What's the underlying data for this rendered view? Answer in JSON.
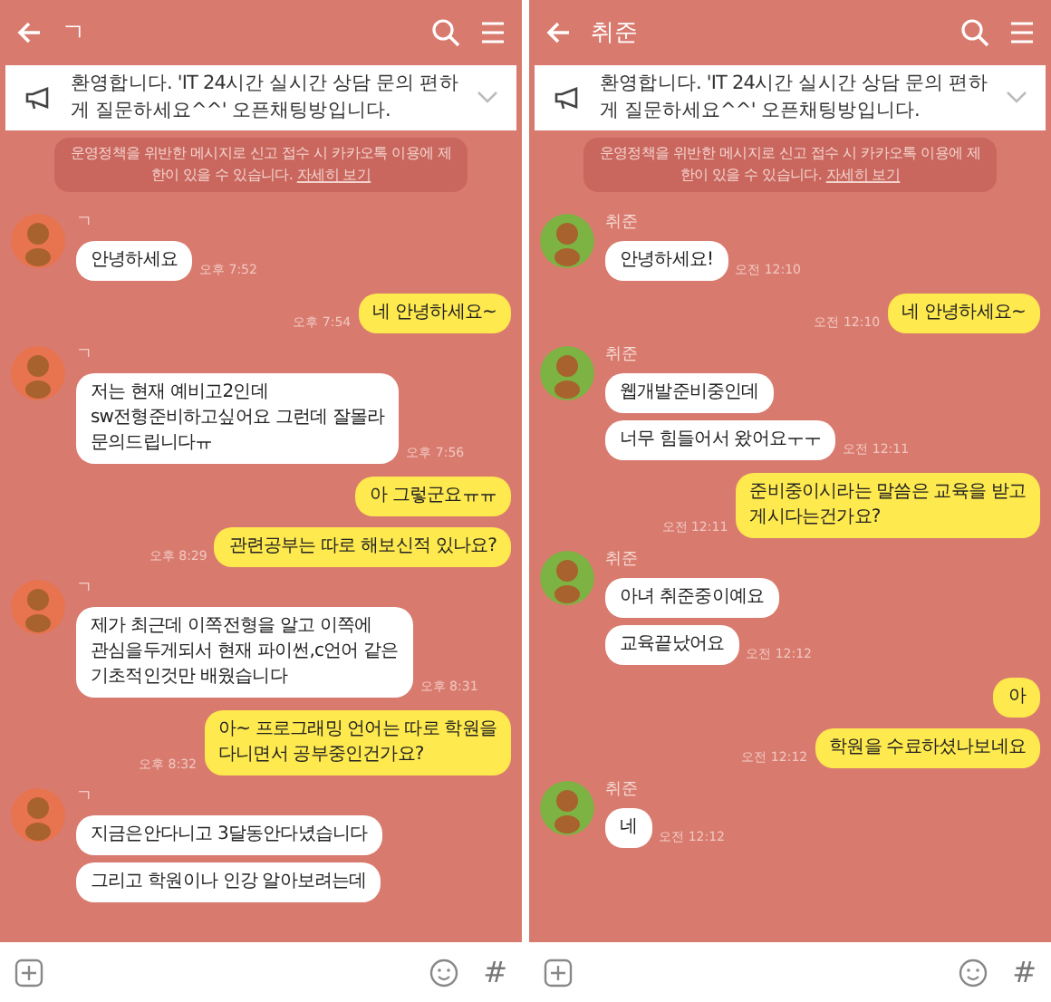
{
  "panels": [
    {
      "title": "ㄱ",
      "color": "#e8734f",
      "notice": "환영합니다. 'IT 24시간 실시간 상담 문의 편하게 질문하세요^^' 오픈채팅방입니다.",
      "policy": {
        "text": "운영정책을 위반한 메시지로 신고 접수 시 카카오톡 이용에 제한이 있을 수 있습니다.",
        "link": "자세히 보기"
      },
      "messages": [
        {
          "kind": "received",
          "sender": "ㄱ",
          "bubbles": [
            "안녕하세요"
          ],
          "time": "오후 7:52"
        },
        {
          "kind": "sent",
          "bubbles": [
            "네 안녕하세요~"
          ],
          "time": "오후 7:54"
        },
        {
          "kind": "received",
          "sender": "ㄱ",
          "bubbles": [
            "저는 현재 예비고2인데\nsw전형준비하고싶어요 그런데 잘몰라\n문의드립니다ㅠ"
          ],
          "time": "오후 7:56"
        },
        {
          "kind": "sent",
          "bubbles": [
            "아 그렇군요ㅠㅠ",
            "관련공부는 따로 해보신적 있나요?"
          ],
          "time": "오후 8:29"
        },
        {
          "kind": "received",
          "sender": "ㄱ",
          "bubbles": [
            "제가 최근데 이쪽전형을 알고 이쪽에\n관심을두게되서 현재 파이썬,c언어 같은\n기초적인것만 배웠습니다"
          ],
          "time": "오후 8:31"
        },
        {
          "kind": "sent",
          "bubbles": [
            "아~ 프로그래밍 언어는 따로 학원을\n다니면서 공부중인건가요?"
          ],
          "time": "오후 8:32"
        },
        {
          "kind": "received",
          "sender": "ㄱ",
          "bubbles": [
            "지금은안다니고 3달동안다녔습니다",
            "그리고 학원이나 인강 알아보려는데"
          ]
        }
      ],
      "input": {
        "hash": "#"
      }
    },
    {
      "title": "취준",
      "color": "#7cb342",
      "notice": "환영합니다. 'IT 24시간 실시간 상담 문의 편하게 질문하세요^^' 오픈채팅방입니다.",
      "policy": {
        "text": "운영정책을 위반한 메시지로 신고 접수 시 카카오톡 이용에 제한이 있을 수 있습니다.",
        "link": "자세히 보기"
      },
      "messages": [
        {
          "kind": "received",
          "sender": "취준",
          "bubbles": [
            "안녕하세요!"
          ],
          "time": "오전 12:10"
        },
        {
          "kind": "sent",
          "bubbles": [
            "네 안녕하세요~"
          ],
          "time": "오전 12:10"
        },
        {
          "kind": "received",
          "sender": "취준",
          "bubbles": [
            "웹개발준비중인데",
            "너무 힘들어서 왔어요ㅜㅜ"
          ],
          "time": "오전 12:11"
        },
        {
          "kind": "sent",
          "bubbles": [
            "준비중이시라는 말씀은 교육을 받고\n게시다는건가요?"
          ],
          "time": "오전 12:11"
        },
        {
          "kind": "received",
          "sender": "취준",
          "bubbles": [
            "아녀 취준중이예요",
            "교육끝났어요"
          ],
          "time": "오전 12:12"
        },
        {
          "kind": "sent",
          "bubbles": [
            "아",
            "학원을 수료하셨나보네요"
          ],
          "time": "오전 12:12"
        },
        {
          "kind": "received",
          "sender": "취준",
          "bubbles": [
            "네"
          ],
          "time": "오전 12:12"
        }
      ],
      "input": {
        "hash": "#"
      }
    }
  ]
}
